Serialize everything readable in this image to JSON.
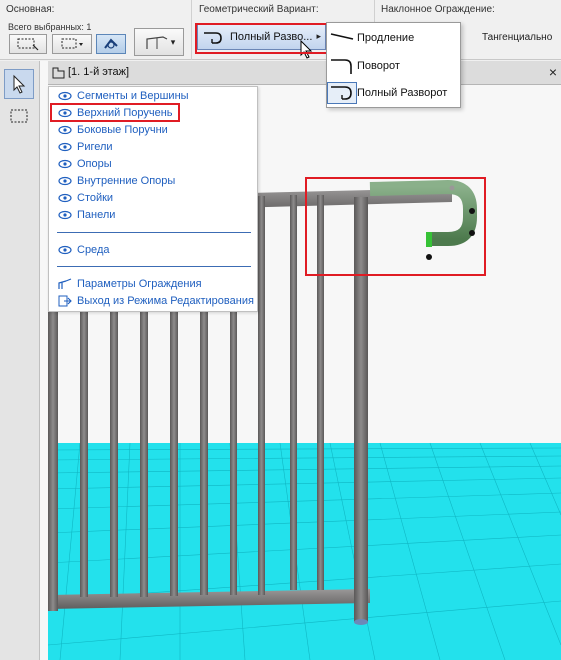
{
  "infobar": {
    "basic": {
      "title": "Основная:",
      "selected_count": "Всего выбранных: 1"
    },
    "geometry": {
      "title": "Геометрический Вариант:",
      "current_variant": "Полный Разво..."
    },
    "slanted": {
      "title": "Наклонное Ограждение:",
      "mode": "Тангенциально"
    }
  },
  "flyout": {
    "items": [
      {
        "label": "Продление",
        "icon": "extension-icon"
      },
      {
        "label": "Поворот",
        "icon": "turn-icon"
      },
      {
        "label": "Полный Разворот",
        "icon": "full-turn-icon",
        "selected": true
      }
    ]
  },
  "tab": {
    "label": "[1. 1-й этаж]"
  },
  "context_menu": {
    "visibility_items": [
      "Сегменты и Вершины",
      "Верхний Поручень",
      "Боковые Поручни",
      "Ригели",
      "Опоры",
      "Внутренние Опоры",
      "Стойки",
      "Панели"
    ],
    "environment": "Среда",
    "settings": "Параметры Ограждения",
    "exit": "Выход из Режима Редактирования"
  },
  "colors": {
    "accent_blue": "#1f5fbf",
    "highlight_red": "#e01c24",
    "rail_gray": "#7a7878",
    "rail_green": "#5f8f5f",
    "ground_cyan": "#29e4ee"
  }
}
